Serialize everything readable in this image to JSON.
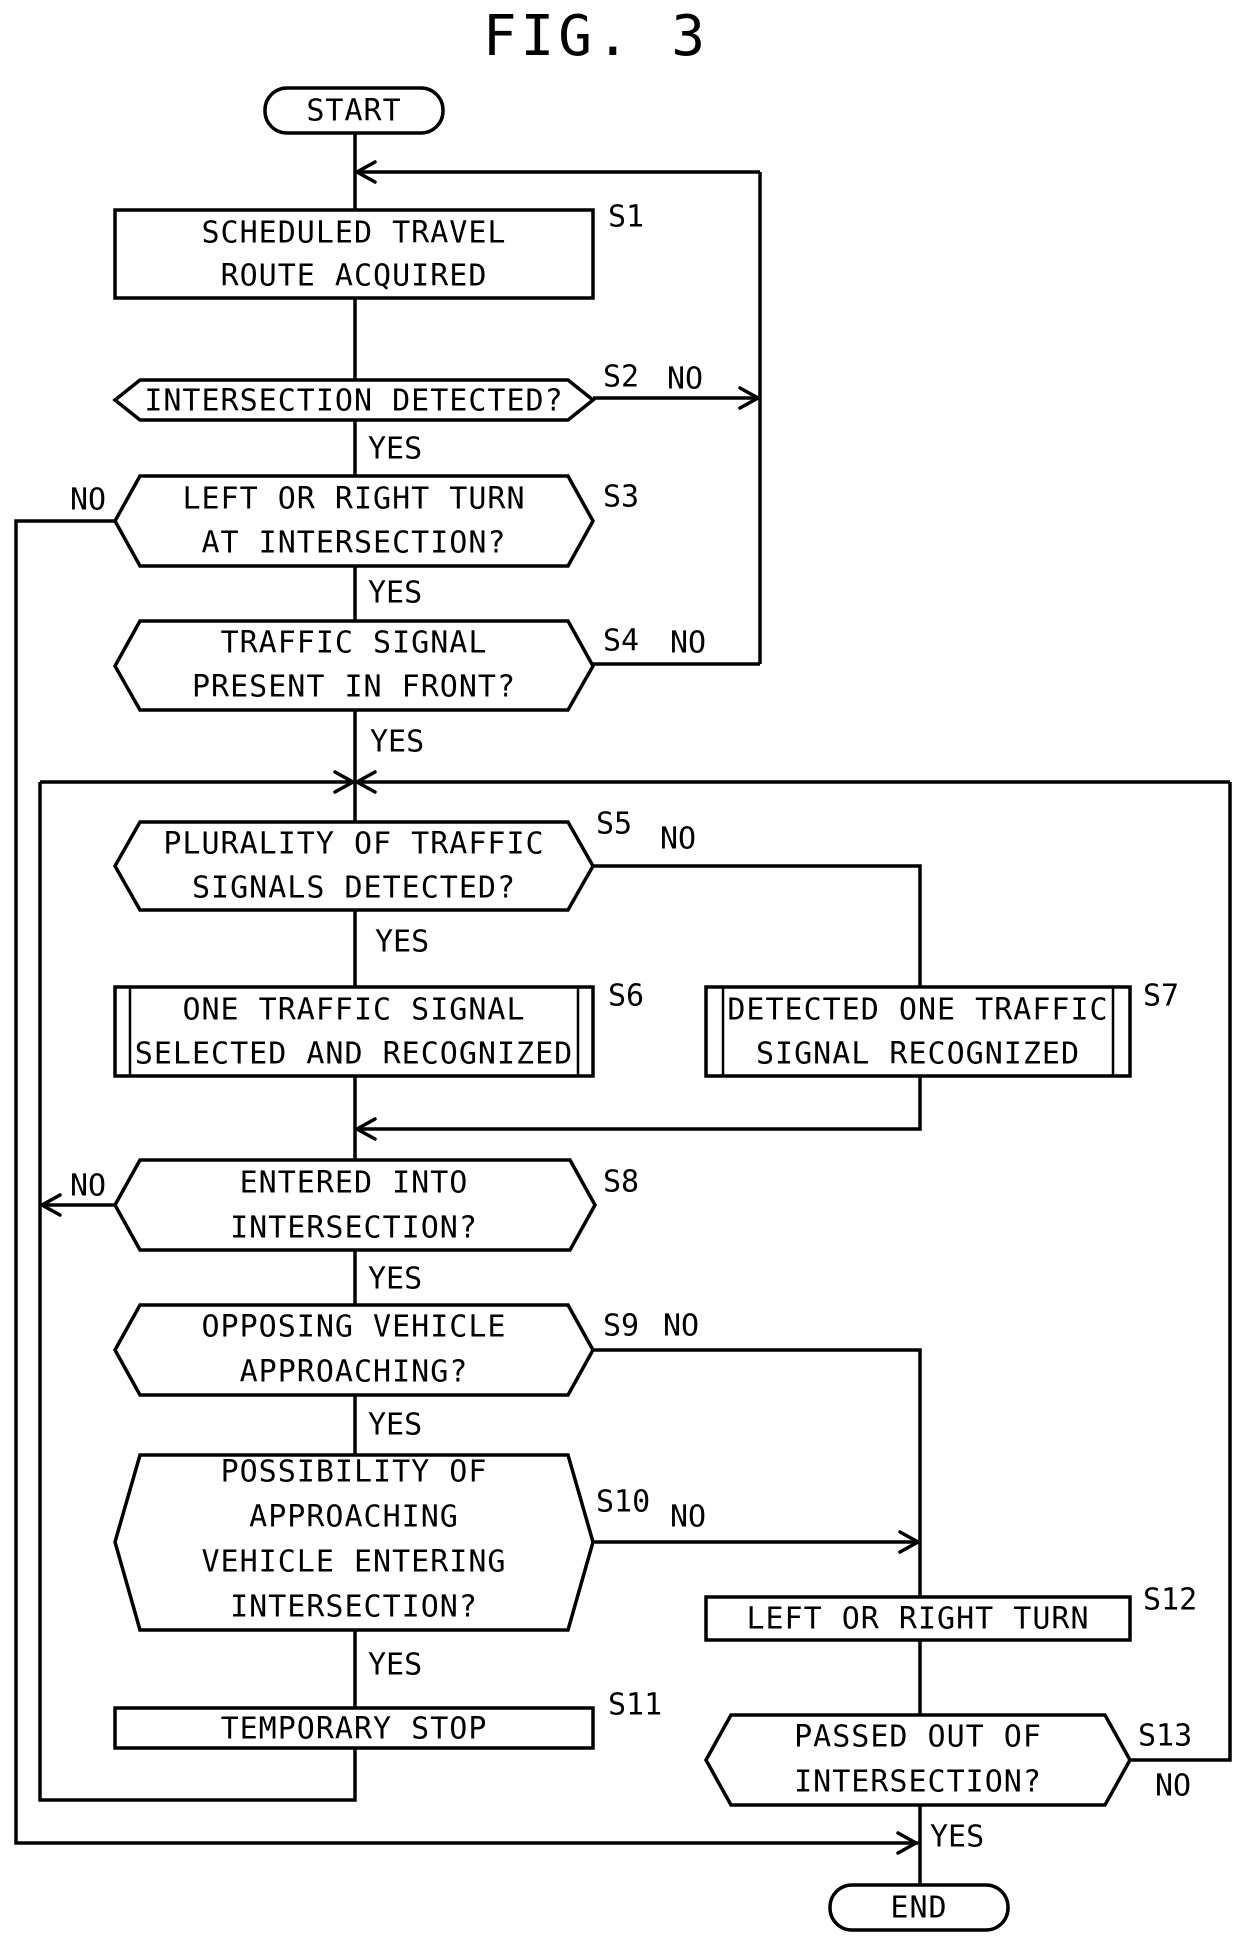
{
  "figure": {
    "title": "FIG. 3"
  },
  "terminals": {
    "start": "START",
    "end": "END"
  },
  "steps": {
    "S1": {
      "id": "S1",
      "type": "process",
      "lines": [
        "SCHEDULED TRAVEL",
        "ROUTE ACQUIRED"
      ]
    },
    "S2": {
      "id": "S2",
      "type": "decision",
      "lines": [
        "INTERSECTION DETECTED?"
      ],
      "yes": "YES",
      "no": "NO"
    },
    "S3": {
      "id": "S3",
      "type": "decision",
      "lines": [
        "LEFT OR RIGHT TURN",
        "AT INTERSECTION?"
      ],
      "yes": "YES",
      "no": "NO"
    },
    "S4": {
      "id": "S4",
      "type": "decision",
      "lines": [
        "TRAFFIC SIGNAL",
        "PRESENT IN FRONT?"
      ],
      "yes": "YES",
      "no": "NO"
    },
    "S5": {
      "id": "S5",
      "type": "decision",
      "lines": [
        "PLURALITY OF TRAFFIC",
        "SIGNALS DETECTED?"
      ],
      "yes": "YES",
      "no": "NO"
    },
    "S6": {
      "id": "S6",
      "type": "subroutine",
      "lines": [
        "ONE TRAFFIC SIGNAL",
        "SELECTED AND RECOGNIZED"
      ]
    },
    "S7": {
      "id": "S7",
      "type": "subroutine",
      "lines": [
        "DETECTED ONE TRAFFIC",
        "SIGNAL RECOGNIZED"
      ]
    },
    "S8": {
      "id": "S8",
      "type": "decision",
      "lines": [
        "ENTERED INTO",
        "INTERSECTION?"
      ],
      "yes": "YES",
      "no": "NO"
    },
    "S9": {
      "id": "S9",
      "type": "decision",
      "lines": [
        "OPPOSING VEHICLE",
        "APPROACHING?"
      ],
      "yes": "YES",
      "no": "NO"
    },
    "S10": {
      "id": "S10",
      "type": "decision",
      "lines": [
        "POSSIBILITY OF",
        "APPROACHING",
        "VEHICLE ENTERING",
        "INTERSECTION?"
      ],
      "yes": "YES",
      "no": "NO"
    },
    "S11": {
      "id": "S11",
      "type": "process",
      "lines": [
        "TEMPORARY STOP"
      ]
    },
    "S12": {
      "id": "S12",
      "type": "process",
      "lines": [
        "LEFT OR RIGHT TURN"
      ]
    },
    "S13": {
      "id": "S13",
      "type": "decision",
      "lines": [
        "PASSED OUT OF",
        "INTERSECTION?"
      ],
      "yes": "YES",
      "no": "NO"
    }
  }
}
